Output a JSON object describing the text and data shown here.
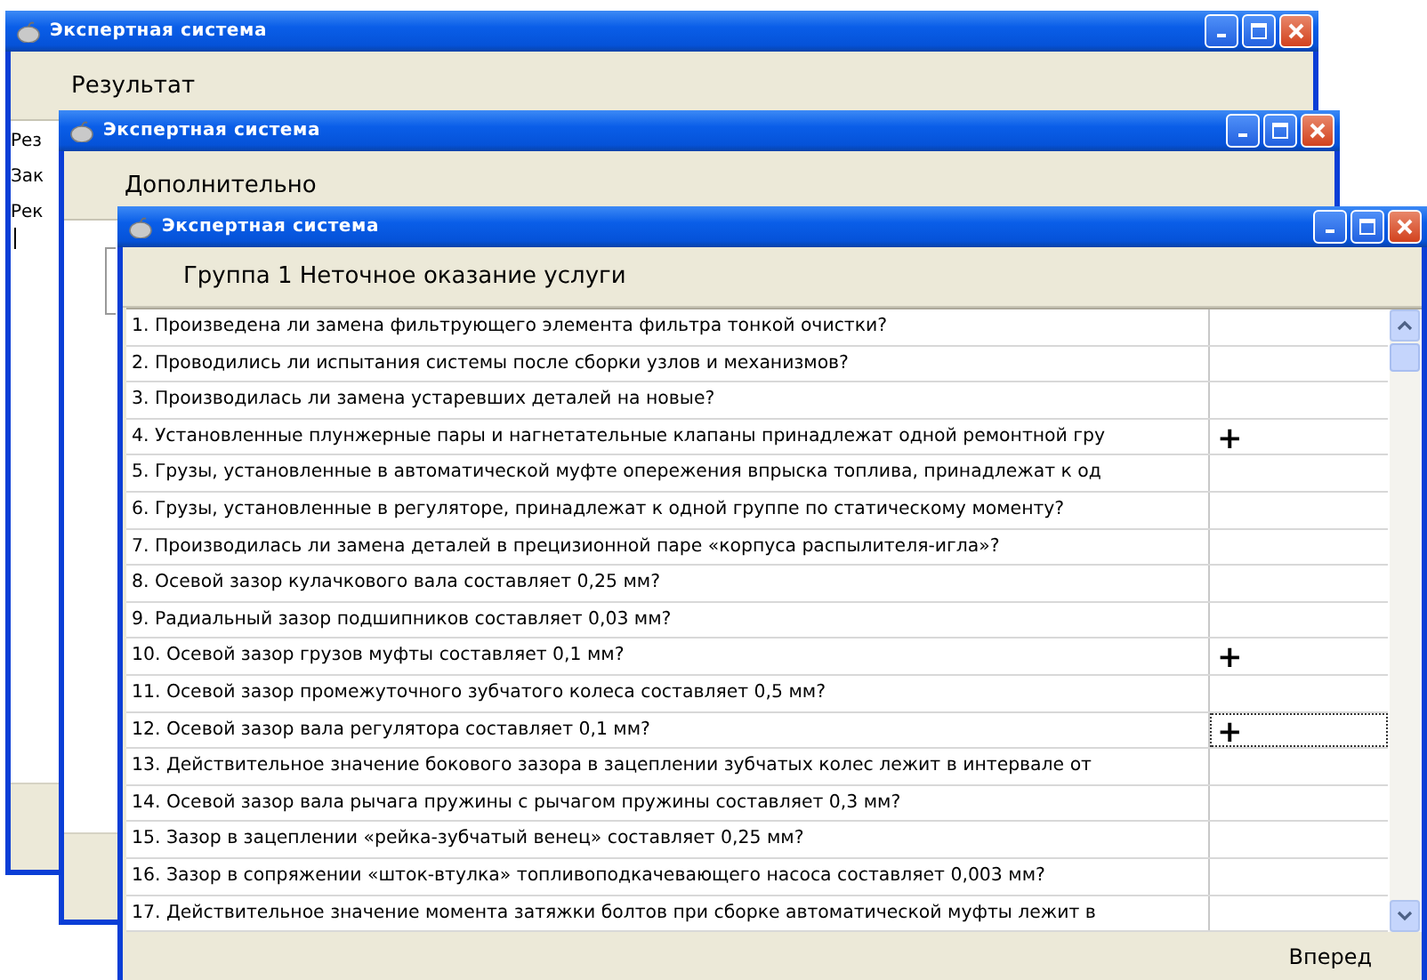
{
  "windows": [
    {
      "title": "Экспертная система",
      "heading": "Результат",
      "labels": [
        "Рез",
        "Зак",
        "Рек"
      ]
    },
    {
      "title": "Экспертная система",
      "heading": "Дополнительно"
    },
    {
      "title": "Экспертная система",
      "heading": "Группа 1 Неточное оказание услуги",
      "questions": [
        {
          "text": "1. Произведена ли замена фильтрующего элемента фильтра тонкой очистки?",
          "focused": false
        },
        {
          "text": "2. Проводились ли испытания системы после сборки узлов и механизмов?",
          "focused": false
        },
        {
          "text": "3. Производилась ли замена устаревших деталей на новые?",
          "focused": false
        },
        {
          "text": "4. Установленные плунжерные пары и нагнетательные клапаны принадлежат одной ремонтной гру",
          "answer": "+",
          "focused": false
        },
        {
          "text": "5. Грузы, установленные в автоматической муфте опережения впрыска топлива, принадлежат к од",
          "focused": false
        },
        {
          "text": "6. Грузы, установленные в регуляторе, принадлежат к одной группе по статическому моменту?",
          "focused": false
        },
        {
          "text": "7. Производилась ли замена деталей в прецизионной паре «корпуса распылителя-игла»?",
          "focused": false
        },
        {
          "text": "8. Осевой зазор кулачкового вала составляет 0,25 мм?",
          "focused": false
        },
        {
          "text": "9. Радиальный зазор подшипников составляет 0,03 мм?",
          "focused": false
        },
        {
          "text": "10. Осевой зазор грузов муфты составляет 0,1 мм?",
          "answer": "+",
          "focused": false
        },
        {
          "text": "11. Осевой зазор промежуточного зубчатого колеса составляет 0,5 мм?",
          "focused": false
        },
        {
          "text": "12. Осевой зазор вала регулятора составляет 0,1 мм?",
          "answer": "+",
          "focused": true
        },
        {
          "text": "13. Действительное значение бокового зазора в зацеплении зубчатых колес лежит в интервале от",
          "focused": false
        },
        {
          "text": "14. Осевой зазор вала рычага пружины с рычагом пружины составляет 0,3 мм?",
          "focused": false
        },
        {
          "text": "15. Зазор в зацеплении «рейка-зубчатый венец»  составляет 0,25 мм?",
          "focused": false
        },
        {
          "text": "16. Зазор в сопряжении «шток-втулка» топливоподкачевающего насоса составляет 0,003 мм?",
          "focused": false
        },
        {
          "text": "17. Действительное значение момента затяжки болтов при сборке автоматической муфты лежит в",
          "focused": false
        }
      ],
      "next_button": "Вперед"
    }
  ]
}
